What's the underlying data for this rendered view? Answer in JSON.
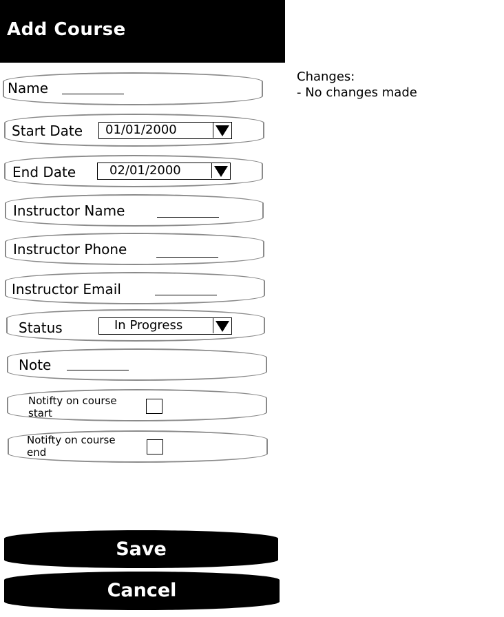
{
  "header": {
    "title": "Add Course"
  },
  "form": {
    "name": {
      "label": "Name",
      "value": ""
    },
    "start_date": {
      "label": "Start Date",
      "value": "01/01/2000"
    },
    "end_date": {
      "label": "End Date",
      "value": "02/01/2000"
    },
    "instructor_name": {
      "label": "Instructor Name",
      "value": ""
    },
    "instructor_phone": {
      "label": "Instructor Phone",
      "value": ""
    },
    "instructor_email": {
      "label": "Instructor Email",
      "value": ""
    },
    "status": {
      "label": "Status",
      "value": "In Progress"
    },
    "note": {
      "label": "Note",
      "value": ""
    },
    "notify_start": {
      "label_line1": "Notifty on course",
      "label_line2": "start",
      "checked": false
    },
    "notify_end": {
      "label_line1": "Notifty on course",
      "label_line2": "end",
      "checked": false
    }
  },
  "changes": {
    "title": "Changes:",
    "items": [
      "- No changes made"
    ]
  },
  "buttons": {
    "save": "Save",
    "cancel": "Cancel"
  },
  "icons": {
    "dropdown": "triangle-down-icon"
  },
  "colors": {
    "header_bg": "#000000",
    "button_bg": "#000000",
    "row_border": "#8a8a8a"
  }
}
